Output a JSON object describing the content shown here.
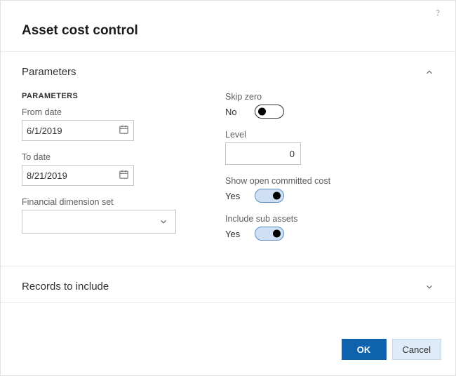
{
  "header": {
    "title": "Asset cost control"
  },
  "sections": {
    "parameters": {
      "title": "Parameters",
      "subheading": "PARAMETERS",
      "from_date_label": "From date",
      "from_date_value": "6/1/2019",
      "to_date_label": "To date",
      "to_date_value": "8/21/2019",
      "fin_dim_label": "Financial dimension set",
      "fin_dim_value": "",
      "skip_zero_label": "Skip zero",
      "skip_zero_value": "No",
      "level_label": "Level",
      "level_value": "0",
      "show_open_label": "Show open committed cost",
      "show_open_value": "Yes",
      "include_sub_label": "Include sub assets",
      "include_sub_value": "Yes"
    },
    "records": {
      "title": "Records to include"
    }
  },
  "footer": {
    "ok": "OK",
    "cancel": "Cancel"
  }
}
